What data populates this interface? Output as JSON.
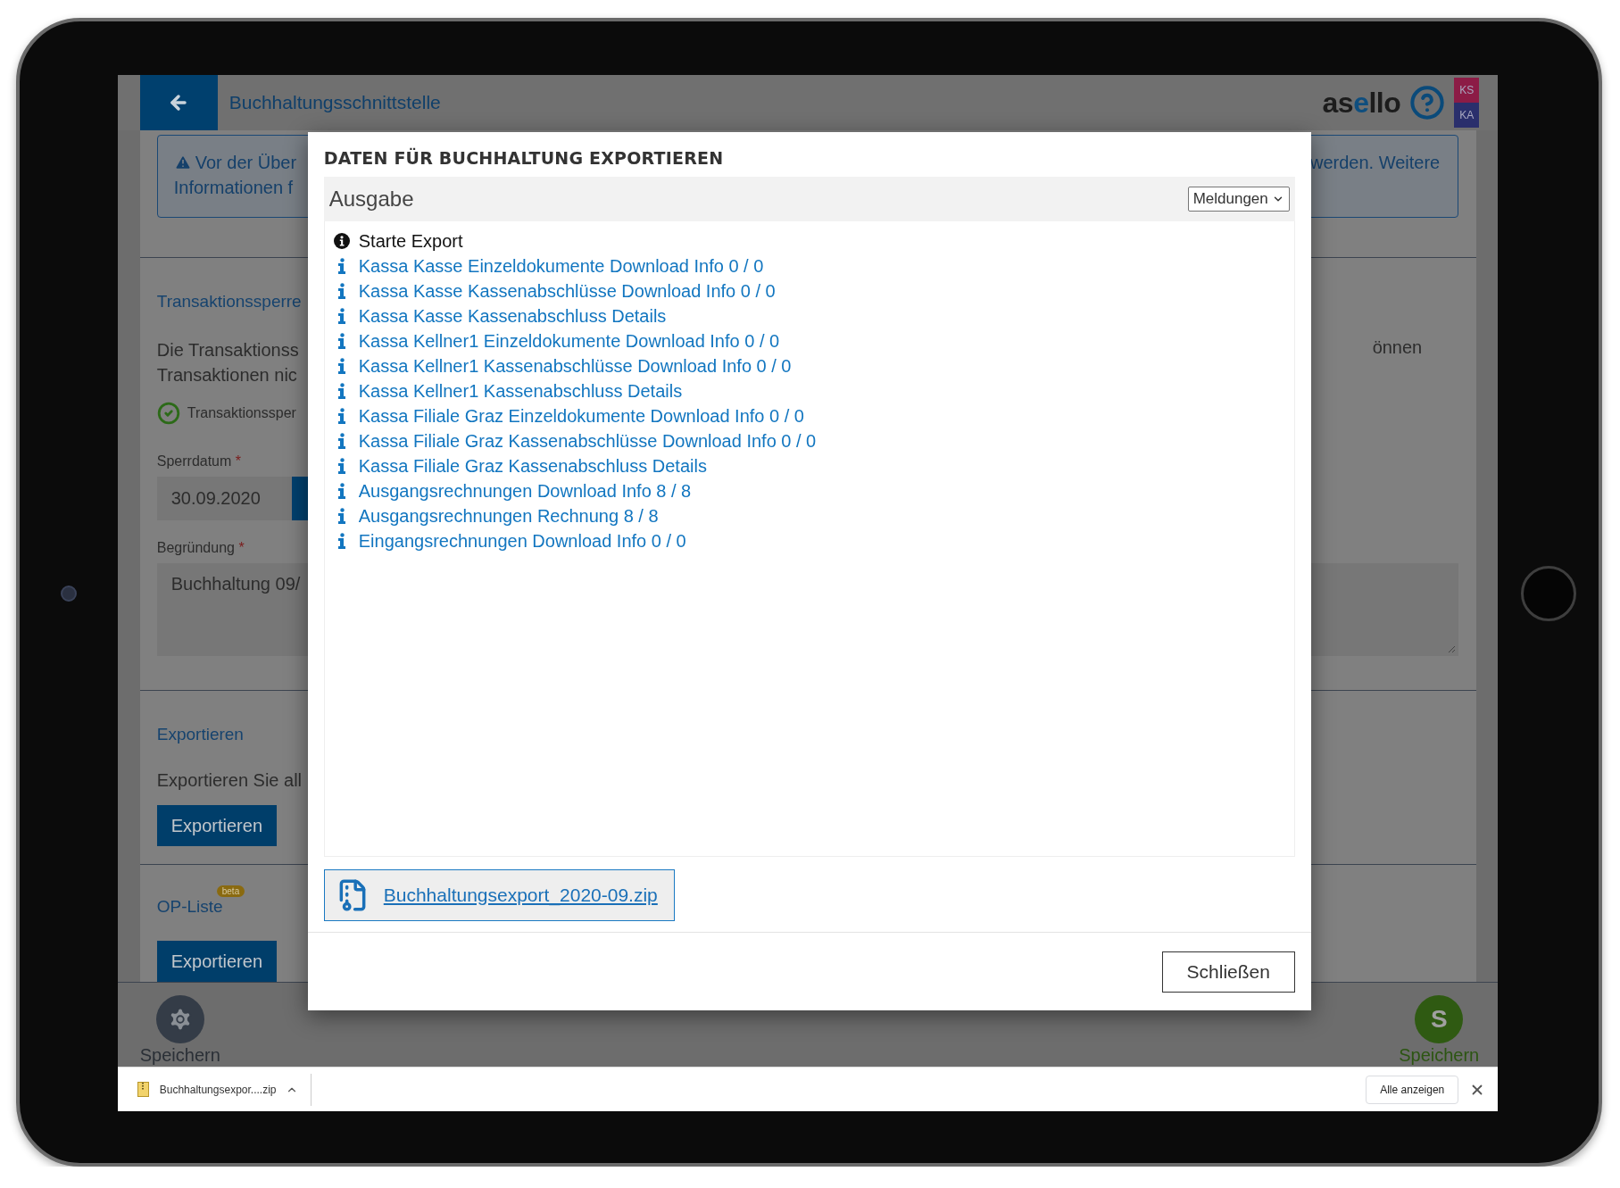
{
  "header": {
    "title": "Buchhaltungsschnittstelle",
    "logo": {
      "start": "as",
      "accent": "e",
      "end": "llo"
    },
    "badges": [
      {
        "label": "KS",
        "color": "#8c1c46"
      },
      {
        "label": "KA",
        "color": "#2a2f6c"
      }
    ]
  },
  "notice": {
    "left_lines": [
      "Vor der Über",
      "Informationen f"
    ],
    "right_line": "werden. Weitere"
  },
  "lock_section": {
    "heading": "Transaktionssperre",
    "left_lines": [
      "Die Transaktionss",
      "Transaktionen nic"
    ],
    "right_line": "önnen",
    "status": "Transaktionssper",
    "date_field": {
      "label": "Sperrdatum",
      "required_mark": "*",
      "value": "30.09.2020"
    },
    "reason_field": {
      "label": "Begründung",
      "required_mark": "*",
      "value": "Buchhaltung 09/"
    }
  },
  "export_section": {
    "heading": "Exportieren",
    "text": "Exportieren Sie all",
    "button": "Exportieren"
  },
  "op_section": {
    "heading": "OP-Liste",
    "badge": "beta",
    "button": "Exportieren"
  },
  "footer": {
    "left_label": "Speichern",
    "right_letter": "S",
    "right_label": "Speichern"
  },
  "download_bar": {
    "file": "Buchhaltungsexpor....zip",
    "show_all": "Alle anzeigen"
  },
  "dialog": {
    "title": "DATEN FÜR BUCHHALTUNG EXPORTIEREN",
    "output_label": "Ausgabe",
    "filter": "Meldungen",
    "messages": [
      {
        "kind": "start",
        "text": "Starte Export"
      },
      {
        "kind": "info",
        "text": "Kassa Kasse Einzeldokumente Download Info 0 / 0"
      },
      {
        "kind": "info",
        "text": "Kassa Kasse Kassenabschlüsse Download Info 0 / 0"
      },
      {
        "kind": "info",
        "text": "Kassa Kasse Kassenabschluss Details"
      },
      {
        "kind": "info",
        "text": "Kassa Kellner1 Einzeldokumente Download Info 0 / 0"
      },
      {
        "kind": "info",
        "text": "Kassa Kellner1 Kassenabschlüsse Download Info 0 / 0"
      },
      {
        "kind": "info",
        "text": "Kassa Kellner1 Kassenabschluss Details"
      },
      {
        "kind": "info",
        "text": "Kassa Filiale Graz Einzeldokumente Download Info 0 / 0"
      },
      {
        "kind": "info",
        "text": "Kassa Filiale Graz Kassenabschlüsse Download Info 0 / 0"
      },
      {
        "kind": "info",
        "text": "Kassa Filiale Graz Kassenabschluss Details"
      },
      {
        "kind": "info",
        "text": "Ausgangsrechnungen Download Info 8 / 8"
      },
      {
        "kind": "info",
        "text": "Ausgangsrechnungen Rechnung 8 / 8"
      },
      {
        "kind": "info",
        "text": "Eingangsrechnungen Download Info 0 / 0"
      }
    ],
    "download_link": "Buchhaltungsexport_2020-09.zip",
    "close_button": "Schließen"
  }
}
